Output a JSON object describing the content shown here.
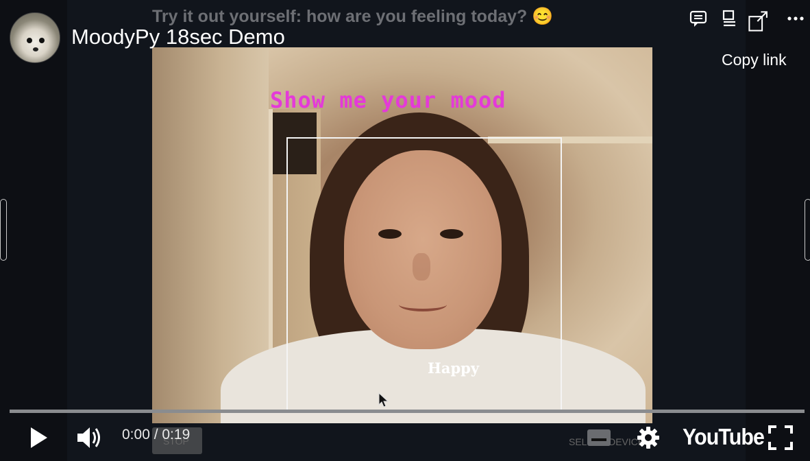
{
  "video": {
    "title": "MoodyPy 18sec Demo",
    "banner": "Try it out yourself: how are you feeling today? 😊",
    "overlay_text": "Show me your mood",
    "emotion_label": "Happy"
  },
  "top_actions": {
    "copy_link_label": "Copy link",
    "icons": [
      "comment-icon",
      "playlist-icon",
      "share-icon",
      "more-icon"
    ]
  },
  "controls": {
    "time": "0:00 / 0:19",
    "stop_label": "STOP",
    "device_label": "SELECT DEVICE",
    "brand": "YouTube",
    "progress": 0
  },
  "colors": {
    "overlay_text": "#e43ad8",
    "banner": "#6d6f74",
    "progress_track": "#8a8c8f"
  }
}
